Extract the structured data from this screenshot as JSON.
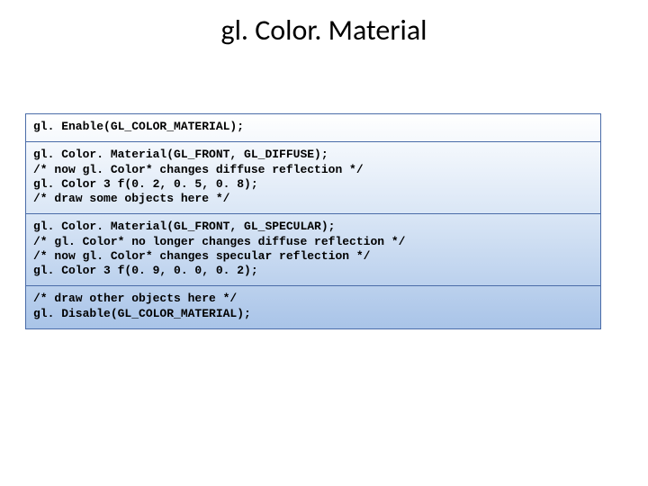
{
  "title": "gl. Color. Material",
  "rows": [
    "gl. Enable(GL_COLOR_MATERIAL);",
    "gl. Color. Material(GL_FRONT, GL_DIFFUSE);\n/* now gl. Color* changes diffuse reflection */\ngl. Color 3 f(0. 2, 0. 5, 0. 8);\n/* draw some objects here */",
    "gl. Color. Material(GL_FRONT, GL_SPECULAR);\n/* gl. Color* no longer changes diffuse reflection */\n/* now gl. Color* changes specular reflection */\ngl. Color 3 f(0. 9, 0. 0, 0. 2);",
    "/* draw other objects here */\ngl. Disable(GL_COLOR_MATERIAL);"
  ]
}
